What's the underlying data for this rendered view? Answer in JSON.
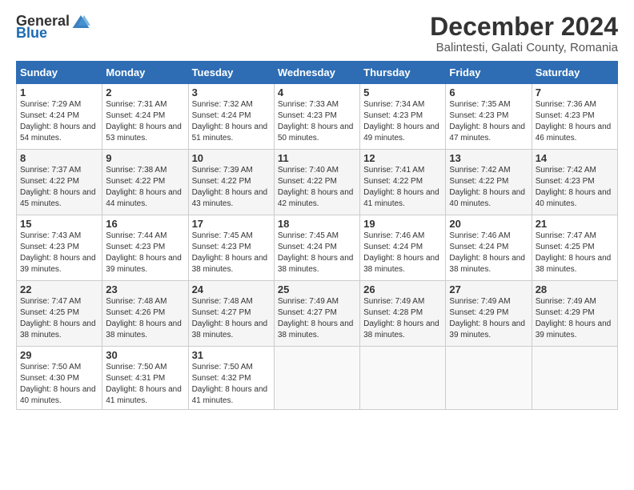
{
  "header": {
    "logo_general": "General",
    "logo_blue": "Blue",
    "title": "December 2024",
    "subtitle": "Balintesti, Galati County, Romania"
  },
  "days_of_week": [
    "Sunday",
    "Monday",
    "Tuesday",
    "Wednesday",
    "Thursday",
    "Friday",
    "Saturday"
  ],
  "weeks": [
    [
      {
        "day": "1",
        "sunrise": "7:29 AM",
        "sunset": "4:24 PM",
        "daylight": "8 hours and 54 minutes."
      },
      {
        "day": "2",
        "sunrise": "7:31 AM",
        "sunset": "4:24 PM",
        "daylight": "8 hours and 53 minutes."
      },
      {
        "day": "3",
        "sunrise": "7:32 AM",
        "sunset": "4:24 PM",
        "daylight": "8 hours and 51 minutes."
      },
      {
        "day": "4",
        "sunrise": "7:33 AM",
        "sunset": "4:23 PM",
        "daylight": "8 hours and 50 minutes."
      },
      {
        "day": "5",
        "sunrise": "7:34 AM",
        "sunset": "4:23 PM",
        "daylight": "8 hours and 49 minutes."
      },
      {
        "day": "6",
        "sunrise": "7:35 AM",
        "sunset": "4:23 PM",
        "daylight": "8 hours and 47 minutes."
      },
      {
        "day": "7",
        "sunrise": "7:36 AM",
        "sunset": "4:23 PM",
        "daylight": "8 hours and 46 minutes."
      }
    ],
    [
      {
        "day": "8",
        "sunrise": "7:37 AM",
        "sunset": "4:22 PM",
        "daylight": "8 hours and 45 minutes."
      },
      {
        "day": "9",
        "sunrise": "7:38 AM",
        "sunset": "4:22 PM",
        "daylight": "8 hours and 44 minutes."
      },
      {
        "day": "10",
        "sunrise": "7:39 AM",
        "sunset": "4:22 PM",
        "daylight": "8 hours and 43 minutes."
      },
      {
        "day": "11",
        "sunrise": "7:40 AM",
        "sunset": "4:22 PM",
        "daylight": "8 hours and 42 minutes."
      },
      {
        "day": "12",
        "sunrise": "7:41 AM",
        "sunset": "4:22 PM",
        "daylight": "8 hours and 41 minutes."
      },
      {
        "day": "13",
        "sunrise": "7:42 AM",
        "sunset": "4:22 PM",
        "daylight": "8 hours and 40 minutes."
      },
      {
        "day": "14",
        "sunrise": "7:42 AM",
        "sunset": "4:23 PM",
        "daylight": "8 hours and 40 minutes."
      }
    ],
    [
      {
        "day": "15",
        "sunrise": "7:43 AM",
        "sunset": "4:23 PM",
        "daylight": "8 hours and 39 minutes."
      },
      {
        "day": "16",
        "sunrise": "7:44 AM",
        "sunset": "4:23 PM",
        "daylight": "8 hours and 39 minutes."
      },
      {
        "day": "17",
        "sunrise": "7:45 AM",
        "sunset": "4:23 PM",
        "daylight": "8 hours and 38 minutes."
      },
      {
        "day": "18",
        "sunrise": "7:45 AM",
        "sunset": "4:24 PM",
        "daylight": "8 hours and 38 minutes."
      },
      {
        "day": "19",
        "sunrise": "7:46 AM",
        "sunset": "4:24 PM",
        "daylight": "8 hours and 38 minutes."
      },
      {
        "day": "20",
        "sunrise": "7:46 AM",
        "sunset": "4:24 PM",
        "daylight": "8 hours and 38 minutes."
      },
      {
        "day": "21",
        "sunrise": "7:47 AM",
        "sunset": "4:25 PM",
        "daylight": "8 hours and 38 minutes."
      }
    ],
    [
      {
        "day": "22",
        "sunrise": "7:47 AM",
        "sunset": "4:25 PM",
        "daylight": "8 hours and 38 minutes."
      },
      {
        "day": "23",
        "sunrise": "7:48 AM",
        "sunset": "4:26 PM",
        "daylight": "8 hours and 38 minutes."
      },
      {
        "day": "24",
        "sunrise": "7:48 AM",
        "sunset": "4:27 PM",
        "daylight": "8 hours and 38 minutes."
      },
      {
        "day": "25",
        "sunrise": "7:49 AM",
        "sunset": "4:27 PM",
        "daylight": "8 hours and 38 minutes."
      },
      {
        "day": "26",
        "sunrise": "7:49 AM",
        "sunset": "4:28 PM",
        "daylight": "8 hours and 38 minutes."
      },
      {
        "day": "27",
        "sunrise": "7:49 AM",
        "sunset": "4:29 PM",
        "daylight": "8 hours and 39 minutes."
      },
      {
        "day": "28",
        "sunrise": "7:49 AM",
        "sunset": "4:29 PM",
        "daylight": "8 hours and 39 minutes."
      }
    ],
    [
      {
        "day": "29",
        "sunrise": "7:50 AM",
        "sunset": "4:30 PM",
        "daylight": "8 hours and 40 minutes."
      },
      {
        "day": "30",
        "sunrise": "7:50 AM",
        "sunset": "4:31 PM",
        "daylight": "8 hours and 41 minutes."
      },
      {
        "day": "31",
        "sunrise": "7:50 AM",
        "sunset": "4:32 PM",
        "daylight": "8 hours and 41 minutes."
      },
      null,
      null,
      null,
      null
    ]
  ],
  "labels": {
    "sunrise": "Sunrise:",
    "sunset": "Sunset:",
    "daylight": "Daylight:"
  }
}
